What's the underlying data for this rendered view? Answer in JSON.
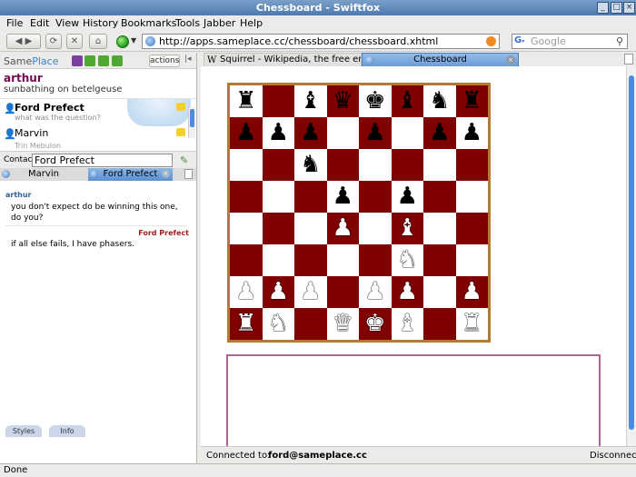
{
  "window": {
    "title": "Chessboard - Swiftfox"
  },
  "menu": [
    "File",
    "Edit",
    "View",
    "History",
    "Bookmarks",
    "Tools",
    "Jabber",
    "Help"
  ],
  "nav": {
    "url": "http://apps.sameplace.cc/chessboard/chessboard.xhtml",
    "search_placeholder": "Google"
  },
  "sidebar": {
    "brand_a": "Same",
    "brand_b": "Place",
    "actions_label": "actions",
    "user": {
      "name": "arthur",
      "status": "sunbathing on betelgeuse"
    },
    "contacts": [
      {
        "name": "Ford Prefect",
        "message": "what was the question?"
      },
      {
        "name": "Marvin",
        "message": ""
      },
      {
        "name": "Trin Mebulon",
        "message": ""
      }
    ],
    "contact_label": "Contact:",
    "contact_value": "Ford Prefect",
    "chat_tabs": [
      "Marvin",
      "Ford Prefect"
    ],
    "messages": [
      {
        "author": "arthur",
        "text": "you don't expect do be winning this one, do you?"
      },
      {
        "author": "Ford Prefect",
        "text": "if all else fails, I have phasers."
      }
    ],
    "bottom_tabs": [
      "Styles",
      "Info"
    ]
  },
  "browser_tabs": [
    {
      "label": "Squirrel - Wikipedia, the free enc..."
    },
    {
      "label": "Chessboard"
    }
  ],
  "chess": {
    "board": [
      [
        "r",
        "",
        "b",
        "q",
        "k",
        "b",
        "n",
        "r"
      ],
      [
        "p",
        "p",
        "p",
        "",
        "p",
        "",
        "p",
        "p"
      ],
      [
        "",
        "",
        "n",
        "",
        "",
        "",
        "",
        ""
      ],
      [
        "",
        "",
        "",
        "p",
        "",
        "p",
        "",
        ""
      ],
      [
        "",
        "",
        "",
        "P",
        "",
        "B",
        "",
        ""
      ],
      [
        "",
        "",
        "",
        "",
        "",
        "N",
        "",
        ""
      ],
      [
        "P",
        "P",
        "P",
        "",
        "P",
        "P",
        "",
        "P"
      ],
      [
        "R",
        "N",
        "",
        "Q",
        "K",
        "B",
        "",
        "R"
      ]
    ],
    "colors": {
      "dark": "#7e0000",
      "light": "#ffffff",
      "frame": "#b57a2f"
    }
  },
  "connection": {
    "label": "Connected to:",
    "account": "ford@sameplace.cc",
    "disconnect": "Disconnect"
  },
  "status": "Done"
}
